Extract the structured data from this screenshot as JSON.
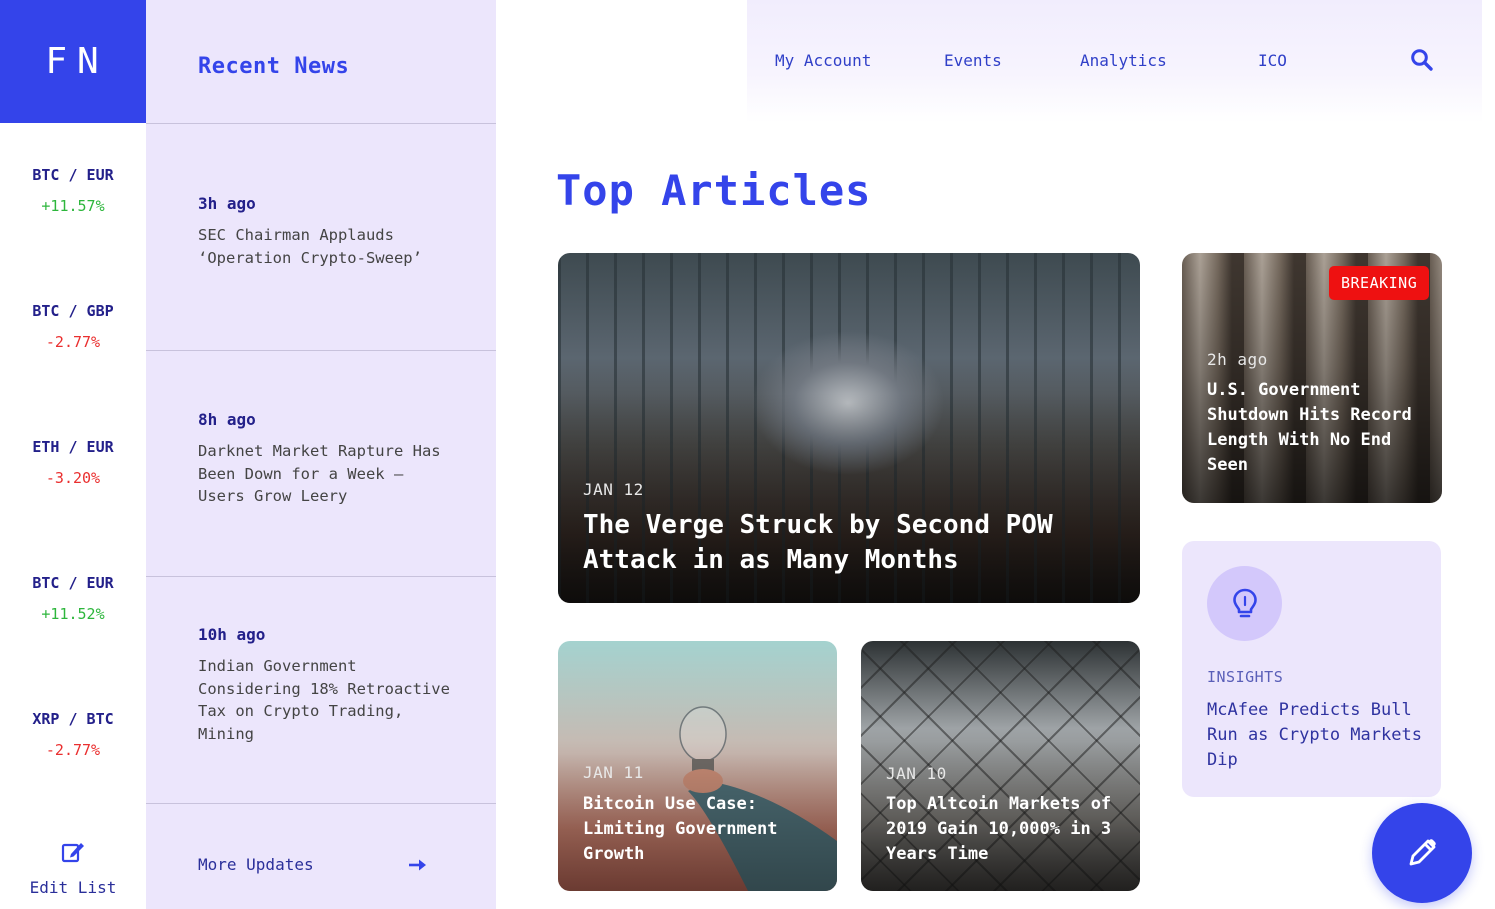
{
  "logo": "FN",
  "tickers": [
    {
      "pair": "BTC / EUR",
      "change": "+11.57%",
      "direction": "up"
    },
    {
      "pair": "BTC / GBP",
      "change": "-2.77%",
      "direction": "down"
    },
    {
      "pair": "ETH / EUR",
      "change": "-3.20%",
      "direction": "down"
    },
    {
      "pair": "BTC / EUR",
      "change": "+11.52%",
      "direction": "up"
    },
    {
      "pair": "XRP / BTC",
      "change": "-2.77%",
      "direction": "down"
    }
  ],
  "edit_list_label": "Edit List",
  "recent_news": {
    "title": "Recent News",
    "items": [
      {
        "ago": "3h ago",
        "headline": "SEC Chairman Applauds ‘Operation Crypto-Sweep’"
      },
      {
        "ago": "8h ago",
        "headline": "Darknet Market Rapture Has Been Down for a Week — Users Grow Leery"
      },
      {
        "ago": "10h ago",
        "headline": "Indian Government Considering 18% Retroactive Tax on Crypto Trading, Mining"
      }
    ],
    "more_label": "More Updates"
  },
  "nav": {
    "items": [
      "My Account",
      "Events",
      "Analytics",
      "ICO"
    ]
  },
  "main": {
    "title": "Top Articles",
    "featured": {
      "date": "JAN 12",
      "title": "The Verge Struck by Second POW Attack in as Many Months"
    },
    "articles": [
      {
        "date": "JAN 11",
        "title": "Bitcoin Use Case: Limiting Government Growth"
      },
      {
        "date": "JAN 10",
        "title": "Top Altcoin Markets of 2019 Gain 10,000% in 3 Years Time"
      }
    ],
    "breaking": {
      "badge": "BREAKING",
      "ago": "2h ago",
      "title": "U.S. Government Shutdown Hits Record Length With No End Seen"
    },
    "insight": {
      "label": "INSIGHTS",
      "title": "McAfee Predicts Bull Run as Crypto Markets Dip"
    }
  },
  "colors": {
    "accent": "#3444ea",
    "up": "#2db63c",
    "down": "#ea2f2f",
    "breaking": "#ee1111",
    "panel": "#ece6fc"
  },
  "icons": [
    "edit-list-icon",
    "arrow-right-icon",
    "search-icon",
    "lightbulb-icon",
    "pencil-icon"
  ]
}
